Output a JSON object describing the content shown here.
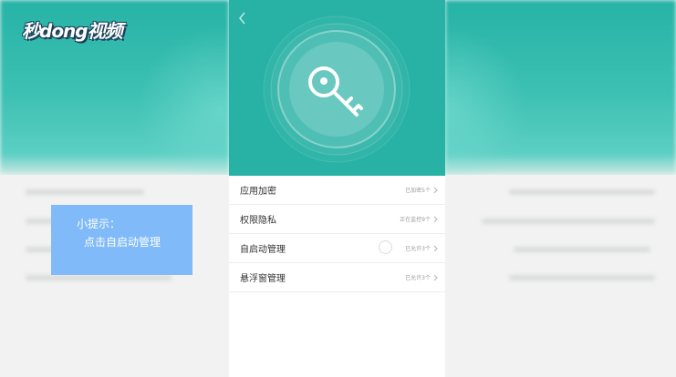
{
  "watermark": {
    "logo_text": "秒dong视频"
  },
  "tip": {
    "title": "小提示：",
    "text": "点击自启动管理"
  },
  "phone": {
    "header": {
      "back_icon": "chevron-left-icon",
      "hero_icon": "key-icon",
      "accent_color": "#27b2a5"
    },
    "menu": [
      {
        "label": "应用加密",
        "status": "已加密5个"
      },
      {
        "label": "权限隐私",
        "status": "正在监控9个"
      },
      {
        "label": "自启动管理",
        "status": "已允许3个"
      },
      {
        "label": "悬浮窗管理",
        "status": "已允许3个"
      }
    ]
  },
  "colors": {
    "tip_background": "#80baf9",
    "header_teal": "#27b2a5"
  }
}
